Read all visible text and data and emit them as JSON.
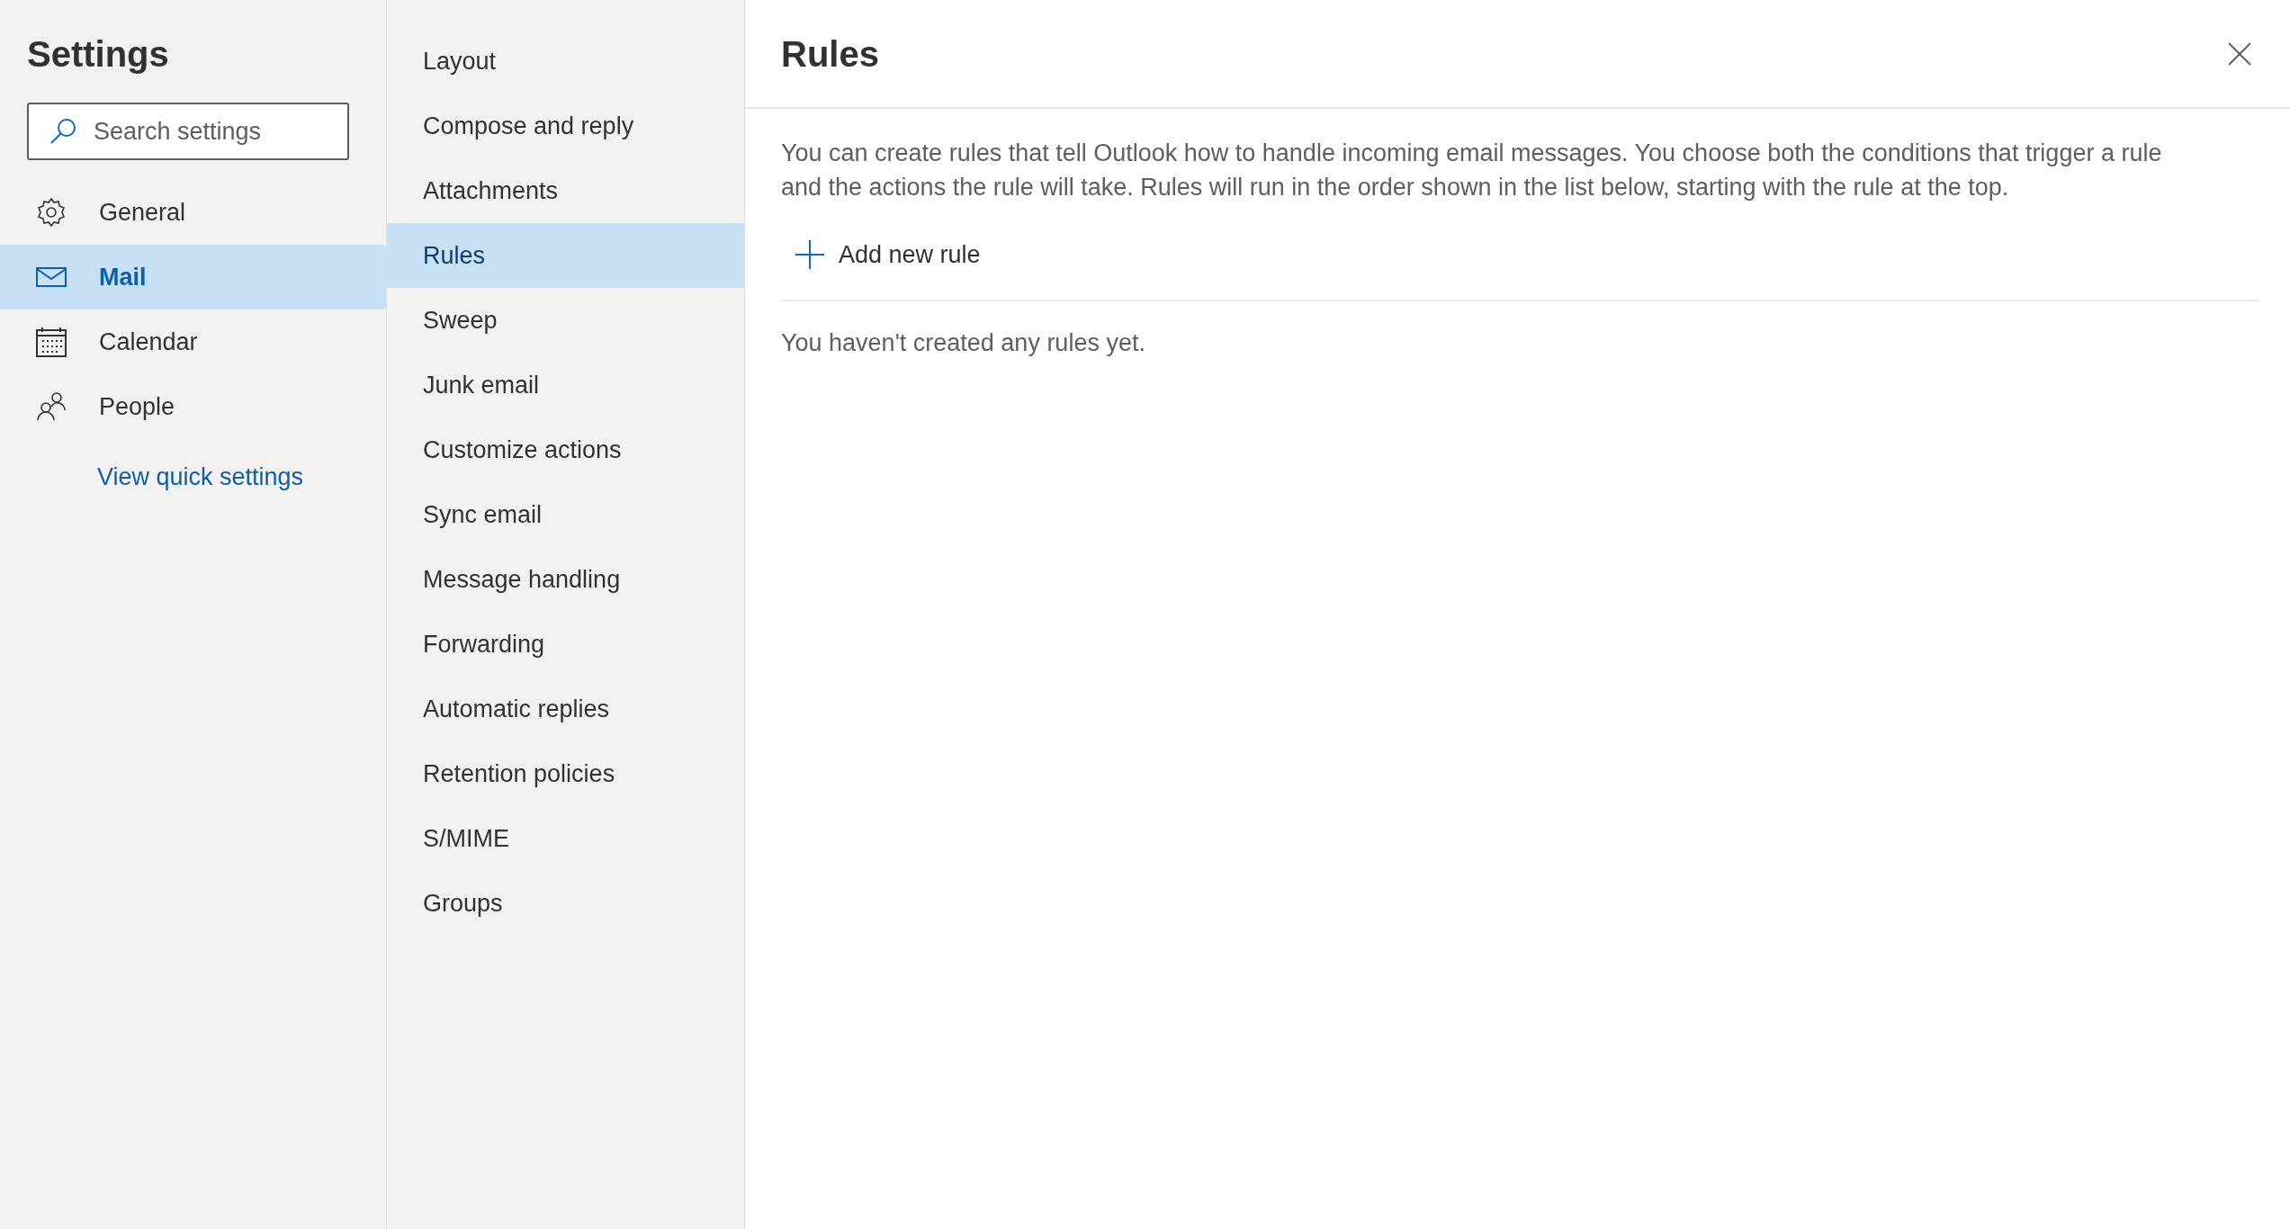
{
  "sidebar": {
    "title": "Settings",
    "search": {
      "placeholder": "Search settings"
    },
    "items": [
      {
        "label": "General",
        "selected": false
      },
      {
        "label": "Mail",
        "selected": true
      },
      {
        "label": "Calendar",
        "selected": false
      },
      {
        "label": "People",
        "selected": false
      }
    ],
    "link": "View quick settings"
  },
  "subnav": {
    "items": [
      {
        "label": "Layout",
        "selected": false
      },
      {
        "label": "Compose and reply",
        "selected": false
      },
      {
        "label": "Attachments",
        "selected": false
      },
      {
        "label": "Rules",
        "selected": true
      },
      {
        "label": "Sweep",
        "selected": false
      },
      {
        "label": "Junk email",
        "selected": false
      },
      {
        "label": "Customize actions",
        "selected": false
      },
      {
        "label": "Sync email",
        "selected": false
      },
      {
        "label": "Message handling",
        "selected": false
      },
      {
        "label": "Forwarding",
        "selected": false
      },
      {
        "label": "Automatic replies",
        "selected": false
      },
      {
        "label": "Retention policies",
        "selected": false
      },
      {
        "label": "S/MIME",
        "selected": false
      },
      {
        "label": "Groups",
        "selected": false
      }
    ]
  },
  "panel": {
    "title": "Rules",
    "description": "You can create rules that tell Outlook how to handle incoming email messages. You choose both the conditions that trigger a rule and the actions the rule will take. Rules will run in the order shown in the list below, starting with the rule at the top.",
    "add_button": "Add new rule",
    "empty_message": "You haven't created any rules yet."
  }
}
